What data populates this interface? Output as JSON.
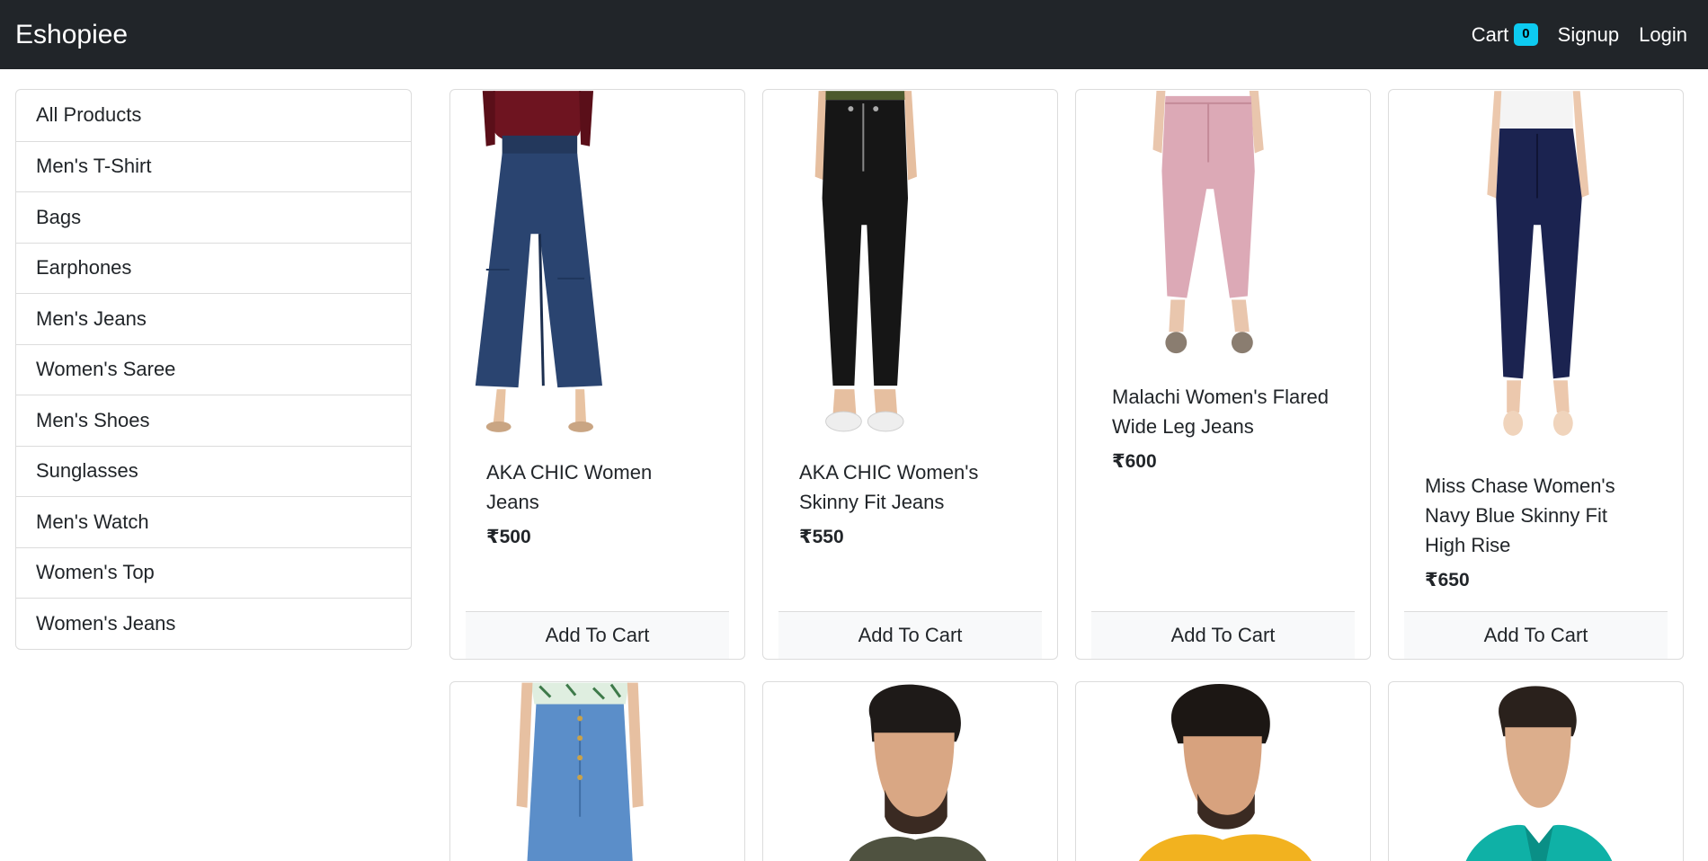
{
  "navbar": {
    "brand": "Eshopiee",
    "cart_label": "Cart",
    "cart_count": "0",
    "signup_label": "Signup",
    "login_label": "Login"
  },
  "sidebar": {
    "items": [
      {
        "label": "All Products"
      },
      {
        "label": "Men's T-Shirt"
      },
      {
        "label": "Bags"
      },
      {
        "label": "Earphones"
      },
      {
        "label": "Men's Jeans"
      },
      {
        "label": "Women's Saree"
      },
      {
        "label": "Men's Shoes"
      },
      {
        "label": "Sunglasses"
      },
      {
        "label": "Men's Watch"
      },
      {
        "label": "Women's Top"
      },
      {
        "label": "Women's Jeans"
      }
    ]
  },
  "products": [
    {
      "title": "AKA CHIC Women Jeans",
      "price": "₹500",
      "button": "Add To Cart"
    },
    {
      "title": "AKA CHIC Women's Skinny Fit Jeans",
      "price": "₹550",
      "button": "Add To Cart"
    },
    {
      "title": "Malachi Women's Flared Wide Leg Jeans",
      "price": "₹600",
      "button": "Add To Cart"
    },
    {
      "title": "Miss Chase Women's Navy Blue Skinny Fit High Rise",
      "price": "₹650",
      "button": "Add To Cart"
    }
  ],
  "colors": {
    "navbar_bg": "#212529",
    "badge": "#0dcaf0",
    "button_bg": "#f8f9fa"
  }
}
